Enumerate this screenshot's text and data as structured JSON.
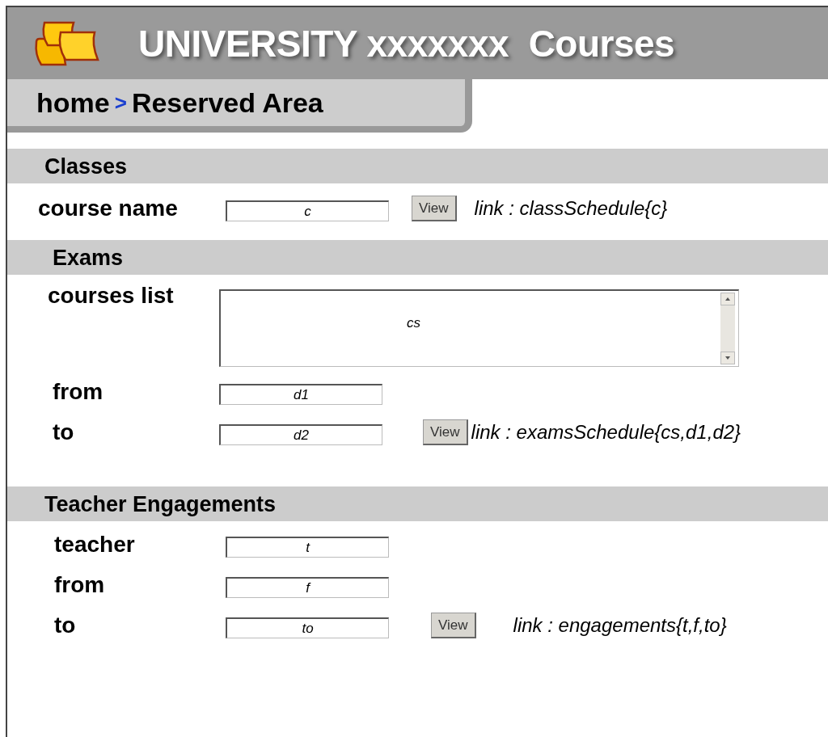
{
  "header": {
    "title": "UNIVERSITY xxxxxxx  Courses"
  },
  "breadcrumb": {
    "home": "home",
    "separator": ">",
    "current": "Reserved Area"
  },
  "sections": [
    {
      "title": "Classes",
      "rows": [
        {
          "kind": "text",
          "label": "course name",
          "value": "c",
          "button": "View",
          "note": "link : classSchedule{c}"
        }
      ]
    },
    {
      "title": "Exams",
      "rows": [
        {
          "kind": "list",
          "label": "courses list",
          "value": "cs"
        },
        {
          "kind": "text",
          "label": "from",
          "value": "d1"
        },
        {
          "kind": "text",
          "label": "to",
          "value": "d2",
          "button": "View",
          "note": "link : examsSchedule{cs,d1,d2}"
        }
      ]
    },
    {
      "title": "Teacher Engagements",
      "rows": [
        {
          "kind": "text",
          "label": "teacher",
          "value": "t"
        },
        {
          "kind": "text",
          "label": "from",
          "value": "f"
        },
        {
          "kind": "text",
          "label": "to",
          "value": "to",
          "button": "View",
          "note": "link : engagements{t,f,to}"
        }
      ]
    }
  ]
}
